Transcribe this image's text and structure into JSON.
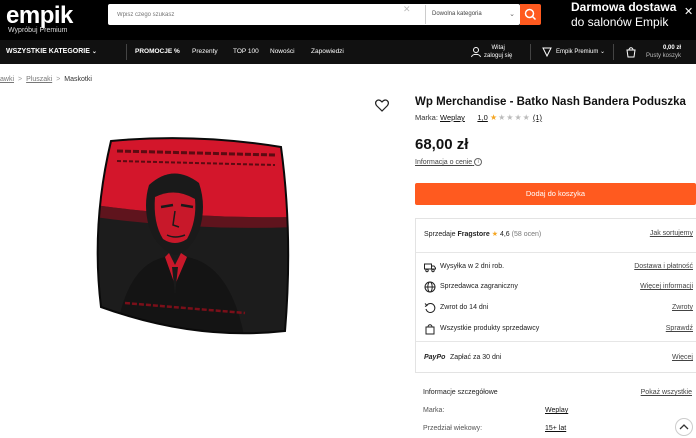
{
  "header": {
    "logo": "empik",
    "logo_sub": "Wypróbuj Premium",
    "search_placeholder": "Wpisz czego szukasz",
    "search_category": "Dowolna kategoria",
    "promo_line1": "Darmowa dostawa",
    "promo_line2": "do salonów Empik"
  },
  "nav": {
    "all_categories": "WSZYSTKIE KATEGORIE",
    "links": [
      "PROMOCJE %",
      "Prezenty",
      "TOP 100",
      "Nowości",
      "Zapowiedzi"
    ],
    "login_line1": "Witaj",
    "login_line2": "zaloguj się",
    "premium": "Empik Premium",
    "basket_price": "0,00 zł",
    "basket_sub": "Pusty koszyk"
  },
  "breadcrumb": {
    "items": [
      "awki",
      "Pluszaki",
      "Maskotki"
    ]
  },
  "product": {
    "image_caption_top": "",
    "title": "Wp Merchandise - Batko Nash Bandera Poduszka",
    "brand_label": "Marka:",
    "brand": "Weplay",
    "rating": "1,0",
    "rating_stars": 1,
    "reviews": "(1)",
    "price": "68,00 zł",
    "price_info": "Informacja o cenie",
    "add_to_cart": "Dodaj do koszyka"
  },
  "seller": {
    "label": "Sprzedaje",
    "name": "Fragstore",
    "score": "4,6",
    "ratings": "(58 ocen)",
    "how_sorted": "Jak sortujemy"
  },
  "rows": [
    {
      "icon": "truck-icon",
      "text": "Wysyłka w 2 dni rob.",
      "action": "Dostawa i płatność"
    },
    {
      "icon": "globe-icon",
      "text": "Sprzedawca zagraniczny",
      "action": "Więcej informacji"
    },
    {
      "icon": "return-icon",
      "text": "Zwrot do 14 dni",
      "action": "Zwroty"
    },
    {
      "icon": "bag-icon",
      "text": "Wszystkie produkty sprzedawcy",
      "action": "Sprawdź"
    },
    {
      "icon": "paypo-icon",
      "text": "Zapłać za 30 dni",
      "action": "Więcej",
      "brand": "PayPo"
    }
  ],
  "details": {
    "title": "Informacje szczegółowe",
    "show_all": "Pokaż wszystkie",
    "items": [
      {
        "label": "Marka:",
        "value": "Weplay"
      },
      {
        "label": "Przedział wiekowy:",
        "value": "15+ lat"
      }
    ]
  },
  "colors": {
    "accent": "#ff5a1f",
    "header": "#000000",
    "pillow_red": "#d3162b",
    "pillow_black": "#1a1a1a"
  }
}
